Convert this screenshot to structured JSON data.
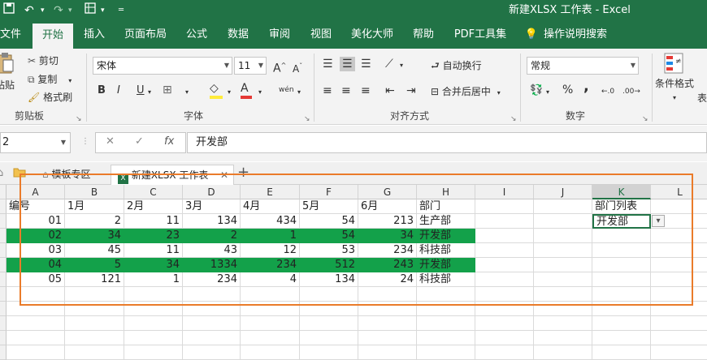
{
  "titlebar": {
    "title": "新建XLSX 工作表  -  Excel",
    "qat": {
      "save_icon": "save-icon",
      "undo_icon": "undo-icon",
      "redo_icon": "redo-icon",
      "form_icon": "form-icon",
      "customize_icon": "chevron-down-icon"
    }
  },
  "ribbon_tabs": [
    "文件",
    "开始",
    "插入",
    "页面布局",
    "公式",
    "数据",
    "审阅",
    "视图",
    "美化大师",
    "帮助",
    "PDF工具集",
    "操作说明搜索"
  ],
  "ribbon": {
    "clipboard": {
      "label": "剪贴板",
      "paste": "粘贴",
      "cut": "剪切",
      "copy": "复制",
      "format_painter": "格式刷"
    },
    "font": {
      "label": "字体",
      "font_name": "宋体",
      "font_size": "11",
      "bold": "B",
      "italic": "I",
      "underline": "U",
      "grow": "A",
      "shrink": "A",
      "phonetic": "wén",
      "fill_color": "#ffeb3b",
      "font_color": "#e53935"
    },
    "alignment": {
      "label": "对齐方式",
      "wrap_text": "自动换行",
      "merge_center": "合并后居中"
    },
    "number": {
      "label": "数字",
      "format": "常规",
      "percent": "%",
      "comma": ","
    },
    "styles": {
      "conditional": "条件格式",
      "overflow": "表"
    }
  },
  "formula_bar": {
    "name_box": "2",
    "cancel": "✕",
    "enter": "✓",
    "fx": "fx",
    "value": "开发部"
  },
  "doc_tabs": [
    {
      "label": "模板专区"
    },
    {
      "label": "新建XLSX 工作表"
    }
  ],
  "sheet": {
    "columns": [
      "A",
      "B",
      "C",
      "D",
      "E",
      "F",
      "G",
      "H",
      "I",
      "J",
      "K",
      "L"
    ],
    "selected_column": "K",
    "header_row": [
      "编号",
      "1月",
      "2月",
      "3月",
      "4月",
      "5月",
      "6月",
      "部门"
    ],
    "rows": [
      [
        "01",
        "2",
        "11",
        "134",
        "434",
        "54",
        "213",
        "生产部"
      ],
      [
        "02",
        "34",
        "23",
        "2",
        "1",
        "54",
        "34",
        "开发部"
      ],
      [
        "03",
        "45",
        "11",
        "43",
        "12",
        "53",
        "234",
        "科技部"
      ],
      [
        "04",
        "5",
        "34",
        "1334",
        "234",
        "512",
        "243",
        "开发部"
      ],
      [
        "05",
        "121",
        "1",
        "234",
        "4",
        "134",
        "24",
        "科技部"
      ]
    ],
    "highlight_color": "#13a14a",
    "dept_list_header": "部门列表",
    "dept_list_value": "开发部"
  },
  "colors": {
    "brand": "#217346",
    "callout": "#ea7b2a"
  }
}
